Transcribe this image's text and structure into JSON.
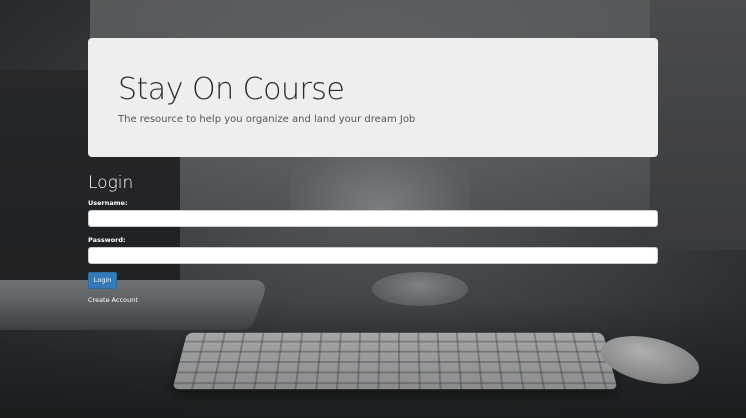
{
  "hero": {
    "title": "Stay On Course",
    "subtitle": "The resource to help you organize and land your dream Job"
  },
  "login": {
    "title": "Login",
    "username_label": "Username:",
    "username_value": "",
    "password_label": "Password:",
    "password_value": "",
    "submit_label": "Login",
    "create_account_label": "Create Account"
  },
  "colors": {
    "hero_background": "#eeeeee",
    "button_primary": "#337ab7",
    "text_on_dark": "#ffffff"
  }
}
